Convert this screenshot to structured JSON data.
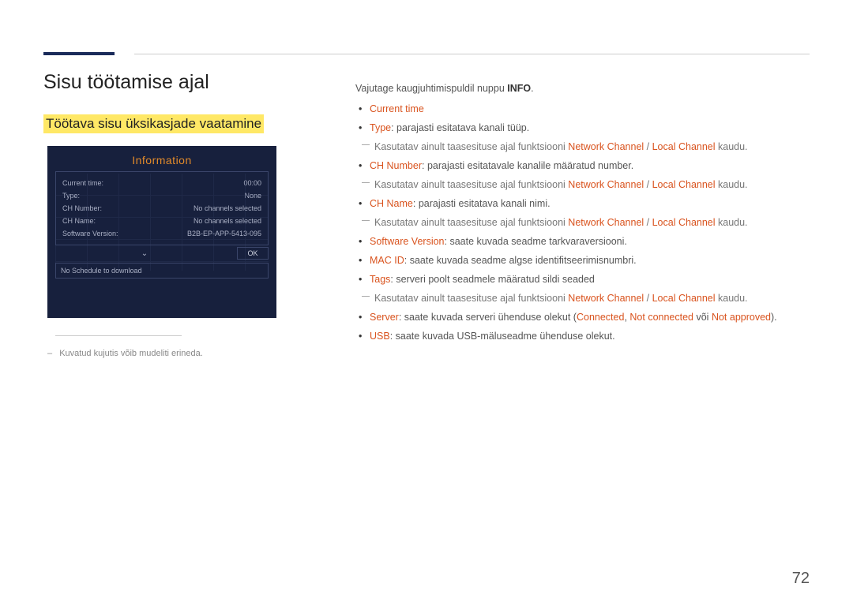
{
  "page_number": "72",
  "title": "Sisu töötamise ajal",
  "subsection": "Töötava sisu üksikasjade vaatamine",
  "info_panel": {
    "heading": "Information",
    "rows": [
      {
        "label": "Current time:",
        "value": "00:00"
      },
      {
        "label": "Type:",
        "value": "None"
      },
      {
        "label": "CH Number:",
        "value": "No channels selected"
      },
      {
        "label": "CH Name:",
        "value": "No channels selected"
      },
      {
        "label": "Software Version:",
        "value": "B2B-EP-APP-5413-095"
      }
    ],
    "ok": "OK",
    "schedule": "No Schedule to download"
  },
  "footnote": "Kuvatud kujutis võib mudeliti erineda.",
  "intro_pre": "Vajutage kaugjuhtimispuldil nuppu ",
  "intro_bold": "INFO",
  "intro_post": ".",
  "items": {
    "current_time": "Current time",
    "type_label": "Type",
    "type_desc": ": parajasti esitatava kanali tüüp.",
    "ch_number_label": "CH Number",
    "ch_number_desc": ": parajasti esitatavale kanalile määratud number.",
    "ch_name_label": "CH Name",
    "ch_name_desc": ": parajasti esitatava kanali nimi.",
    "sw_label": "Software Version",
    "sw_desc": ": saate kuvada seadme tarkvaraversiooni.",
    "mac_label": "MAC ID",
    "mac_desc": ": saate kuvada seadme algse identifitseerimisnumbri.",
    "tags_label": "Tags",
    "tags_desc": ": serveri poolt seadmele määratud sildi seaded",
    "server_label": "Server",
    "server_desc_pre": ": saate kuvada serveri ühenduse olekut (",
    "server_connected": "Connected",
    "server_sep1": ", ",
    "server_not_connected": "Not connected",
    "server_sep2": " või ",
    "server_not_approved": "Not approved",
    "server_post": ").",
    "usb_label": "USB",
    "usb_desc": ": saate kuvada USB-mäluseadme ühenduse olekut.",
    "usable_pre": "Kasutatav ainult taasesituse ajal funktsiooni ",
    "nc": "Network Channel",
    "slash": " / ",
    "lc": "Local Channel",
    "usable_post": " kaudu."
  }
}
